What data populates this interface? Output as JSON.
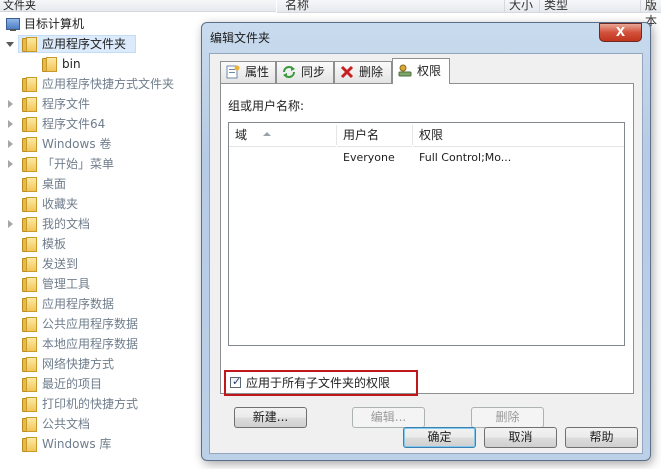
{
  "left_pane": {
    "header": "文件夹",
    "root_label": "目标计算机",
    "items": [
      {
        "label": "应用程序文件夹",
        "expanded": true,
        "selected": true
      },
      {
        "label": "bin",
        "child": true
      },
      {
        "label": "应用程序快捷方式文件夹"
      },
      {
        "label": "程序文件",
        "has_children": true
      },
      {
        "label": "程序文件64",
        "has_children": true
      },
      {
        "label": "Windows 卷",
        "has_children": true
      },
      {
        "label": "「开始」菜单",
        "has_children": true
      },
      {
        "label": "桌面"
      },
      {
        "label": "收藏夹"
      },
      {
        "label": "我的文档",
        "has_children": true
      },
      {
        "label": "模板"
      },
      {
        "label": "发送到"
      },
      {
        "label": "管理工具"
      },
      {
        "label": "应用程序数据"
      },
      {
        "label": "公共应用程序数据"
      },
      {
        "label": "本地应用程序数据"
      },
      {
        "label": "网络快捷方式"
      },
      {
        "label": "最近的项目"
      },
      {
        "label": "打印机的快捷方式"
      },
      {
        "label": "公共文档"
      },
      {
        "label": "Windows 库"
      }
    ]
  },
  "right_pane": {
    "columns": [
      "名称",
      "大小",
      "类型",
      "版本"
    ]
  },
  "dialog": {
    "title": "编辑文件夹",
    "close_symbol": "X",
    "tabs": [
      {
        "label": "属性",
        "icon": "properties-icon"
      },
      {
        "label": "同步",
        "icon": "sync-icon"
      },
      {
        "label": "删除",
        "icon": "delete-x-icon"
      },
      {
        "label": "权限",
        "icon": "permissions-key-icon",
        "active": true
      }
    ],
    "group_label": "组或用户名称:",
    "list_columns": [
      "域",
      "用户名",
      "权限"
    ],
    "rows": [
      {
        "domain": "",
        "user": "Everyone",
        "permission": "Full Control;Mo..."
      }
    ],
    "apply_to_subfolders": {
      "label": "应用于所有子文件夹的权限",
      "checked": true
    },
    "buttons": {
      "new": "新建...",
      "edit": "编辑...",
      "delete": "删除"
    },
    "footer": {
      "ok": "确定",
      "cancel": "取消",
      "help": "帮助"
    },
    "colors": {
      "highlight_border": "#c0171b",
      "close_button": "#d2513b"
    }
  }
}
